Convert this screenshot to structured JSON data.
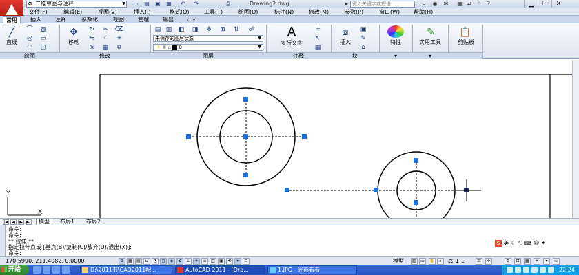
{
  "titlebar": {
    "workspace": "二维草图与注释",
    "document": "Drawing2.dwg",
    "search_placeholder": "键入关键字或短语"
  },
  "menubar": {
    "items": [
      "文件(F)",
      "编辑(E)",
      "视图(V)",
      "插入(I)",
      "格式(O)",
      "工具(T)",
      "绘图(D)",
      "标注(N)",
      "修改(M)",
      "参数(P)",
      "窗口(W)",
      "帮助(H)"
    ]
  },
  "ribbon_tabs": [
    "常用",
    "插入",
    "注释",
    "参数化",
    "视图",
    "管理",
    "输出"
  ],
  "ribbon": {
    "line_label": "直线",
    "move_label": "移动",
    "layer_state": "未保存的图层状态",
    "layer_current": "0",
    "mtext_label": "多行文字",
    "insert_label": "插入",
    "properties_label": "特性",
    "utilities_label": "实用工具",
    "clipboard_label": "剪贴板",
    "panels": [
      "绘图",
      "修改",
      "图层",
      "注释",
      "块"
    ]
  },
  "layout_tabs": [
    "模型",
    "布局1",
    "布局2"
  ],
  "command": {
    "lines": [
      "命令:",
      "命令:",
      "** 拉伸 **",
      "指定拉伸点或 [基点(B)/复制(C)/放弃(U)/退出(X)]:",
      "命令:"
    ]
  },
  "ime": {
    "label": "英"
  },
  "status": {
    "coords": "170.5990, 211.4082, 0.0000",
    "model_label": "模型",
    "scale": "1:1"
  },
  "taskbar": {
    "start_label": "开始",
    "tasks": [
      "D:\\2011书\\CAD2011配...",
      "AutoCAD 2011 - [Dra...",
      "1.JPG - 光影看看"
    ],
    "clock": "22:24"
  }
}
